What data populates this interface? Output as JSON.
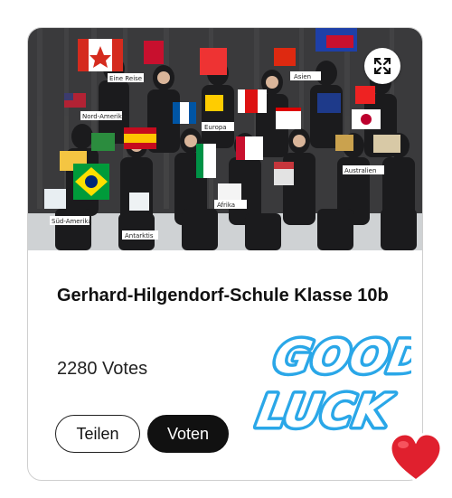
{
  "card": {
    "title": "Gerhard-Hilgendorf-Schule Klasse 10b",
    "votes": "2280 Votes",
    "share_label": "Teilen",
    "vote_label": "Voten"
  },
  "photo": {
    "sign_labels": [
      "Eine Reise",
      "Nord-Amerika",
      "Süd-Amerika",
      "Antarktis",
      "Europa",
      "Afrika",
      "Asien",
      "Australien"
    ]
  },
  "sticker": {
    "line1": "GOOD",
    "line2": "LUCK"
  },
  "icons": {
    "expand": "expand-icon",
    "heart": "heart-icon"
  },
  "colors": {
    "accent_blue": "#2aa7e8",
    "heart_red": "#e0202e",
    "button_dark": "#111111"
  }
}
